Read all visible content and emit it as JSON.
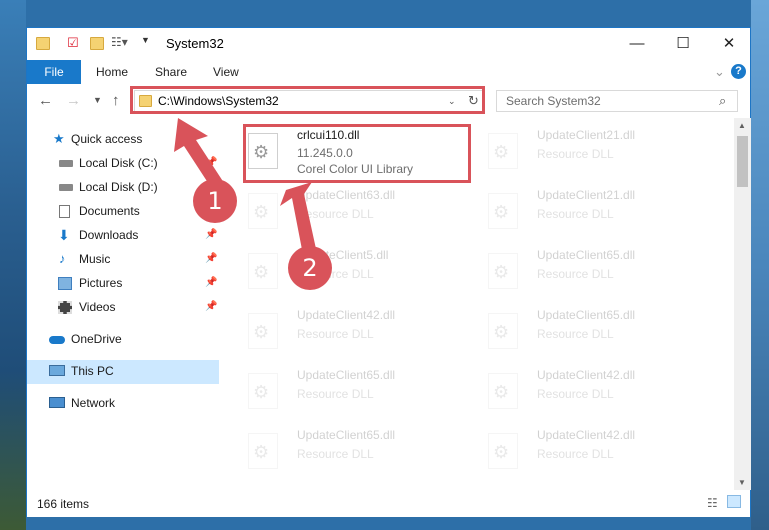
{
  "window": {
    "title": "System32",
    "controls": {
      "minimize": "—",
      "maximize": "☐",
      "close": "✕"
    }
  },
  "ribbon": {
    "file": "File",
    "tabs": [
      "Home",
      "Share",
      "View"
    ],
    "help": "?",
    "expand": "⌄"
  },
  "nav": {
    "address": "C:\\Windows\\System32",
    "search_placeholder": "Search System32"
  },
  "sidebar": {
    "items": [
      {
        "label": "Quick access",
        "icon": "star-icon",
        "pinned": false
      },
      {
        "label": "Local Disk (C:)",
        "icon": "drive-icon",
        "pinned": true
      },
      {
        "label": "Local Disk (D:)",
        "icon": "drive-icon",
        "pinned": false
      },
      {
        "label": "Documents",
        "icon": "documents-icon",
        "pinned": true
      },
      {
        "label": "Downloads",
        "icon": "download-icon",
        "pinned": true
      },
      {
        "label": "Music",
        "icon": "music-icon",
        "pinned": true
      },
      {
        "label": "Pictures",
        "icon": "pictures-icon",
        "pinned": true
      },
      {
        "label": "Videos",
        "icon": "videos-icon",
        "pinned": true
      },
      {
        "label": "OneDrive",
        "icon": "cloud-icon",
        "pinned": false
      },
      {
        "label": "This PC",
        "icon": "computer-icon",
        "pinned": false,
        "selected": true
      },
      {
        "label": "Network",
        "icon": "network-icon",
        "pinned": false
      }
    ]
  },
  "files": {
    "highlighted": {
      "name": "crlcui110.dll",
      "version": "11.245.0.0",
      "description": "Corel Color UI Library"
    },
    "left_column": [
      {
        "name": "UpdateClient63.dll",
        "type": "Resource DLL"
      },
      {
        "name": "UpdateClient5.dll",
        "type": "Resource DLL"
      },
      {
        "name": "UpdateClient42.dll",
        "type": "Resource DLL"
      },
      {
        "name": "UpdateClient65.dll",
        "type": "Resource DLL"
      },
      {
        "name": "UpdateClient65.dll",
        "type": "Resource DLL"
      }
    ],
    "right_column": [
      {
        "name": "UpdateClient21.dll",
        "type": "Resource DLL"
      },
      {
        "name": "UpdateClient21.dll",
        "type": "Resource DLL"
      },
      {
        "name": "UpdateClient65.dll",
        "type": "Resource DLL"
      },
      {
        "name": "UpdateClient65.dll",
        "type": "Resource DLL"
      },
      {
        "name": "UpdateClient42.dll",
        "type": "Resource DLL"
      },
      {
        "name": "UpdateClient42.dll",
        "type": "Resource DLL"
      }
    ]
  },
  "status": {
    "item_count": "166 items"
  },
  "annotations": {
    "step1": "1",
    "step2": "2"
  },
  "colors": {
    "accent": "#1979ca",
    "highlight": "#d9535a",
    "selected_bg": "#cce8ff"
  }
}
